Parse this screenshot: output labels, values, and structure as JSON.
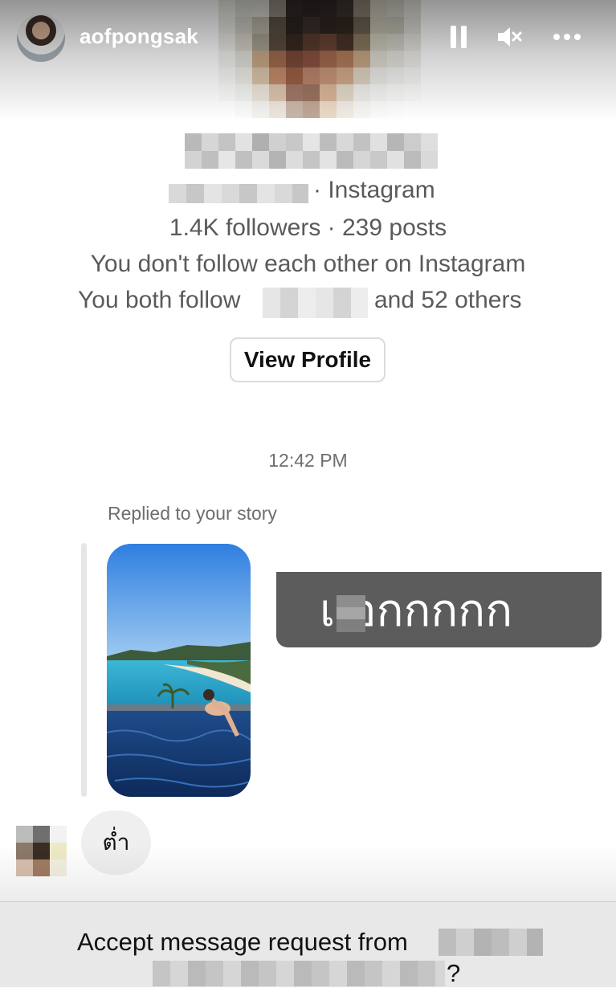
{
  "story": {
    "username": "aofpongsak",
    "icons": [
      "pause-icon",
      "mute-icon",
      "more-icon"
    ]
  },
  "profile": {
    "platform_suffix": "· Instagram",
    "stats": "1.4K followers · 239 posts",
    "follow_status": "You don't follow each other on Instagram",
    "mutual_prefix": "You both follow",
    "mutual_suffix": "and 52 others",
    "view_profile_label": "View Profile"
  },
  "conversation": {
    "timestamp": "12:42 PM",
    "reply_label": "Replied to your story",
    "story_caption": "เ อกกกกก",
    "message": "ต่ำ"
  },
  "request": {
    "text": "Accept message request from",
    "question_mark": "?"
  },
  "colors": {
    "accent_text": "#262626",
    "muted_text": "#5a5a5a",
    "caption_bg": "#5c5c5c",
    "bubble_bg": "#efefef",
    "request_bar_bg": "#e8e8e8"
  }
}
